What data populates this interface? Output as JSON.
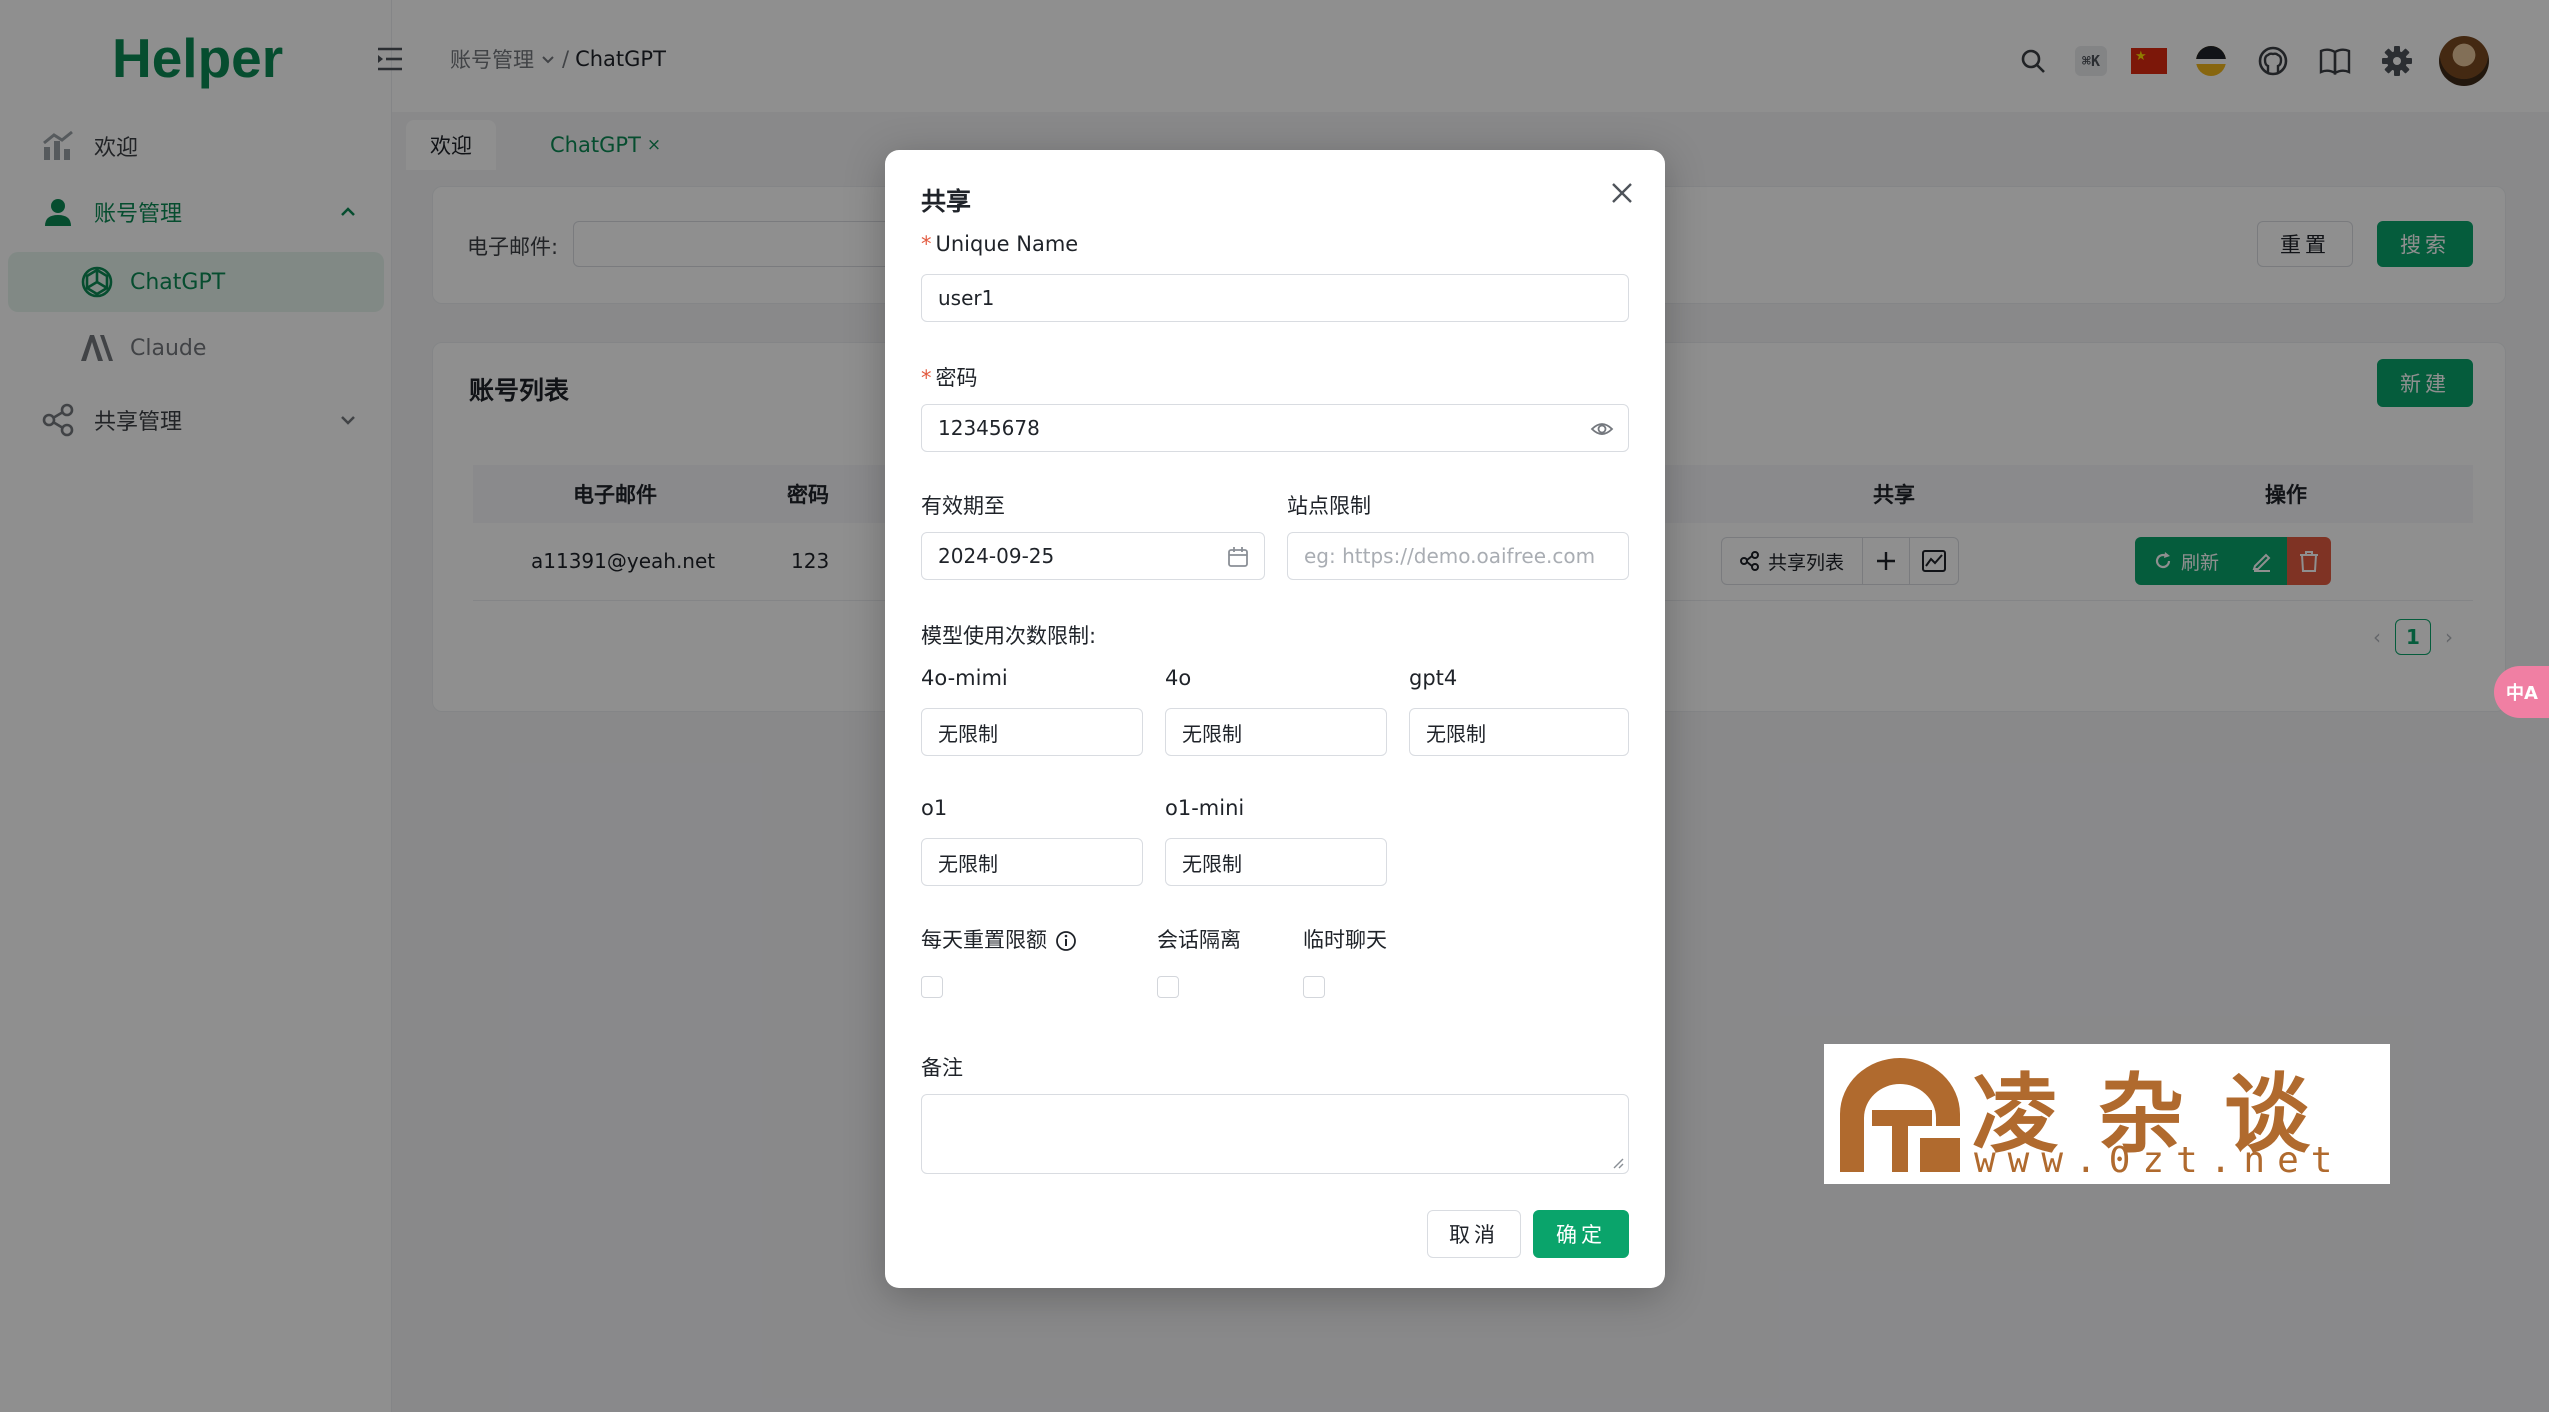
{
  "app": {
    "logo": "Helper"
  },
  "sidebar": {
    "items": [
      {
        "label": "欢迎",
        "icon": "chart-icon"
      },
      {
        "label": "账号管理",
        "icon": "user-icon"
      },
      {
        "label": "ChatGPT",
        "icon": "openai-icon"
      },
      {
        "label": "Claude",
        "icon": "anthropic-icon"
      },
      {
        "label": "共享管理",
        "icon": "share-icon"
      }
    ]
  },
  "header": {
    "breadcrumb": [
      "账号管理",
      "ChatGPT"
    ],
    "breadcrumb_sep": "/",
    "shortcut": "⌘K"
  },
  "tabs": [
    {
      "label": "欢迎"
    },
    {
      "label": "ChatGPT",
      "close": "×"
    }
  ],
  "search": {
    "email_label": "电子邮件:",
    "reset_label": "重置",
    "search_label": "搜索"
  },
  "list": {
    "title": "账号列表",
    "new_label": "新建",
    "columns": [
      "电子邮件",
      "密码",
      "共享",
      "操作"
    ],
    "rows": [
      {
        "email": "a11391@yeah.net",
        "password": "123"
      }
    ],
    "share_list_label": "共享列表",
    "refresh_label": "刷新",
    "page": "1",
    "prev": "‹",
    "next": "›"
  },
  "translate_bubble": "中A",
  "watermark": {
    "chars": "凌杂谈",
    "url": "www.0zt.net"
  },
  "modal": {
    "title": "共享",
    "unique_name_label": "Unique Name",
    "unique_name_value": "user1",
    "password_label": "密码",
    "password_value": "12345678",
    "expire_label": "有效期至",
    "expire_value": "2024-09-25",
    "site_label": "站点限制",
    "site_placeholder": "eg: https://demo.oaifree.com",
    "model_limit_label": "模型使用次数限制:",
    "models": [
      {
        "name": "4o-mimi",
        "value": "无限制"
      },
      {
        "name": "4o",
        "value": "无限制"
      },
      {
        "name": "gpt4",
        "value": "无限制"
      },
      {
        "name": "o1",
        "value": "无限制"
      },
      {
        "name": "o1-mini",
        "value": "无限制"
      }
    ],
    "daily_reset_label": "每天重置限额",
    "session_isolation_label": "会话隔离",
    "temp_chat_label": "临时聊天",
    "note_label": "备注",
    "cancel_label": "取消",
    "confirm_label": "确定"
  },
  "colors": {
    "brand": "#0c8a55",
    "primary": "#0aa46b",
    "danger": "#e35b40"
  }
}
